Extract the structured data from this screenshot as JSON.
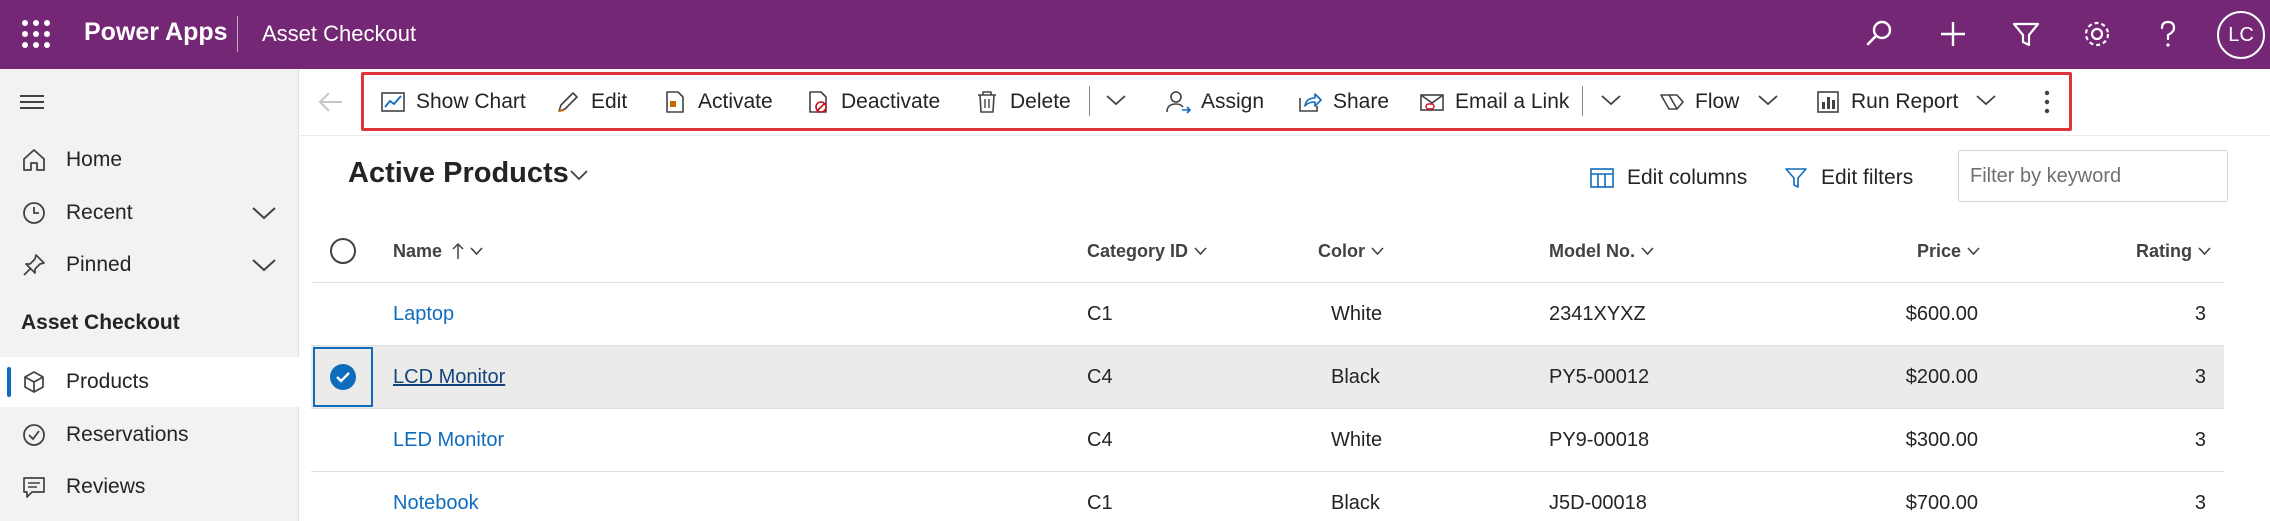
{
  "topbar": {
    "brand": "Power Apps",
    "app_name": "Asset Checkout",
    "avatar_initials": "LC",
    "background": "#742774"
  },
  "sidebar": {
    "items": [
      {
        "label": "Home",
        "icon": "home-icon"
      },
      {
        "label": "Recent",
        "icon": "clock-icon"
      },
      {
        "label": "Pinned",
        "icon": "pin-icon"
      }
    ],
    "section_heading": "Asset Checkout",
    "section_items": [
      {
        "label": "Products",
        "icon": "cube-icon",
        "active": true
      },
      {
        "label": "Reservations",
        "icon": "check-circle-icon",
        "active": false
      },
      {
        "label": "Reviews",
        "icon": "comment-icon",
        "active": false
      }
    ]
  },
  "commands": {
    "show_chart": "Show Chart",
    "edit": "Edit",
    "activate": "Activate",
    "deactivate": "Deactivate",
    "delete": "Delete",
    "assign": "Assign",
    "share": "Share",
    "email_link": "Email a Link",
    "flow": "Flow",
    "run_report": "Run Report"
  },
  "view": {
    "title": "Active Products",
    "edit_columns": "Edit columns",
    "edit_filters": "Edit filters",
    "filter_placeholder": "Filter by keyword"
  },
  "grid": {
    "columns": {
      "name": "Name",
      "category": "Category ID",
      "color": "Color",
      "model": "Model No.",
      "price": "Price",
      "rating": "Rating"
    },
    "rows": [
      {
        "name": "Laptop",
        "category": "C1",
        "color": "White",
        "model": "2341XYXZ",
        "price": "$600.00",
        "rating": "3",
        "selected": false
      },
      {
        "name": "LCD Monitor",
        "category": "C4",
        "color": "Black",
        "model": "PY5-00012",
        "price": "$200.00",
        "rating": "3",
        "selected": true
      },
      {
        "name": "LED Monitor",
        "category": "C4",
        "color": "White",
        "model": "PY9-00018",
        "price": "$300.00",
        "rating": "3",
        "selected": false
      },
      {
        "name": "Notebook",
        "category": "C1",
        "color": "Black",
        "model": "J5D-00018",
        "price": "$700.00",
        "rating": "3",
        "selected": false
      }
    ]
  },
  "colors": {
    "accent": "#0f6cbd",
    "highlight_border": "#e0343a"
  }
}
